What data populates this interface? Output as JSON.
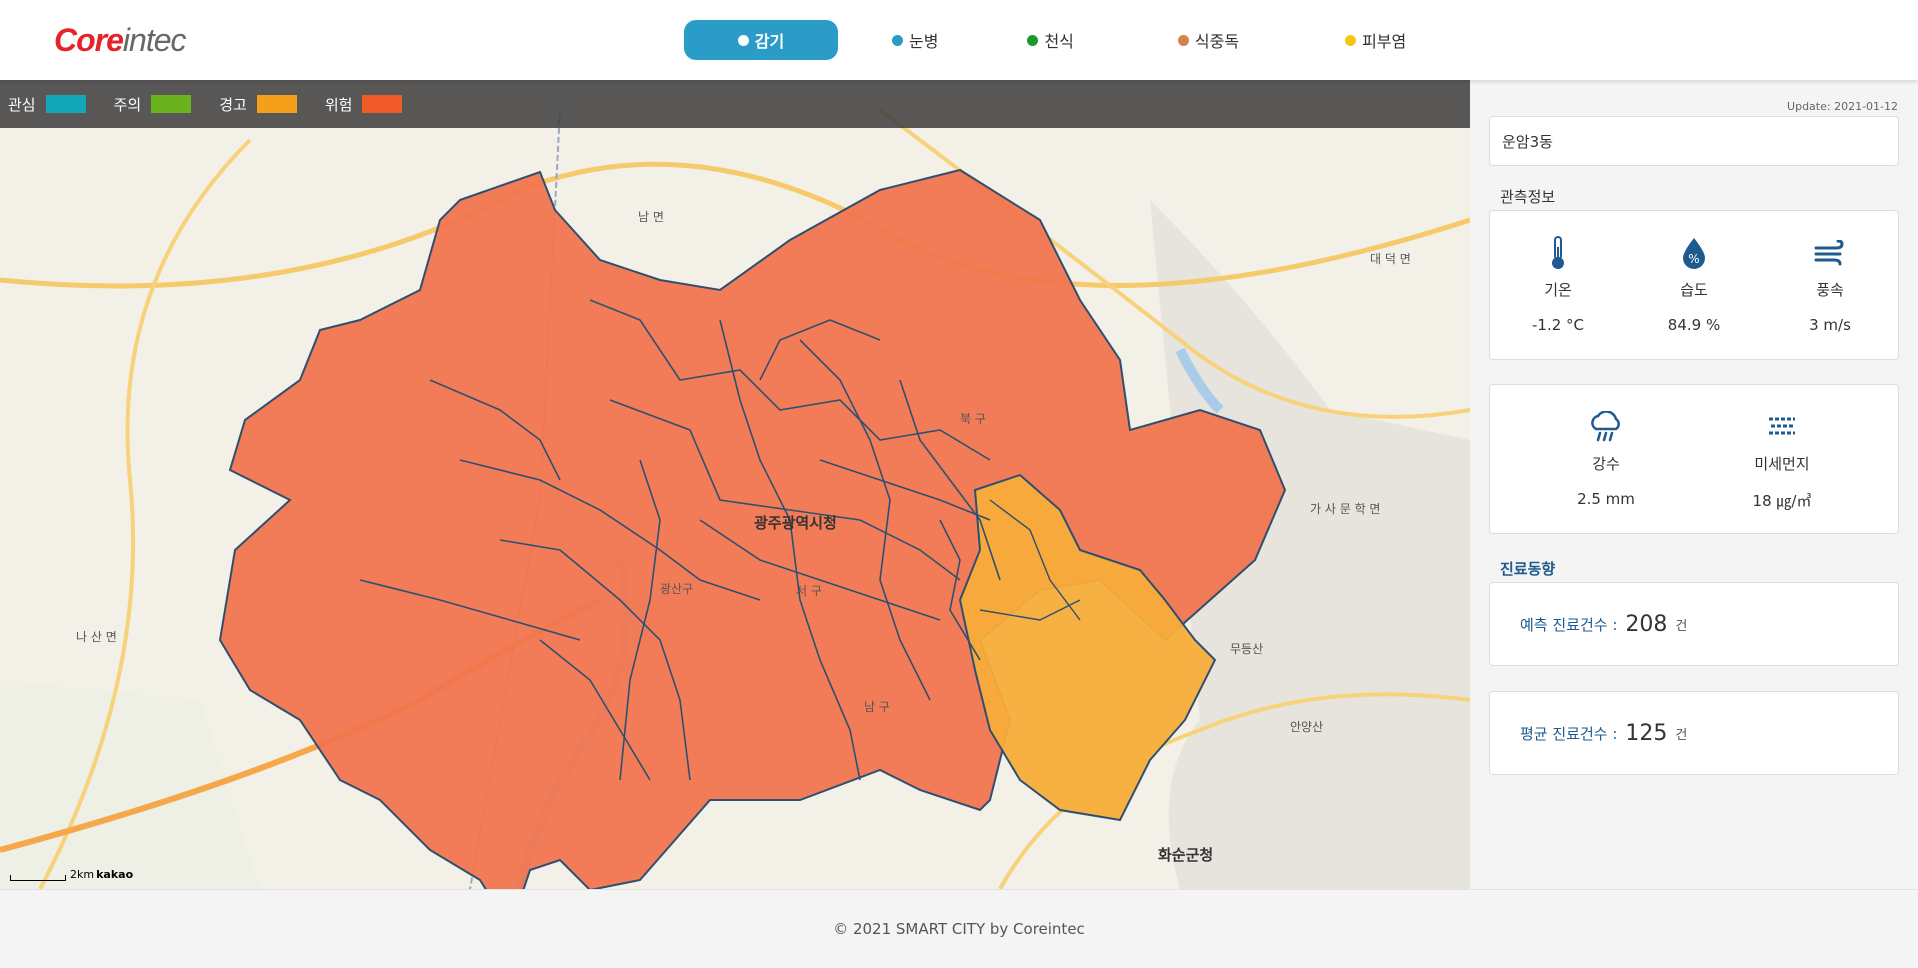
{
  "header": {
    "logo_core": "Core",
    "logo_intec": "intec",
    "tabs": [
      {
        "label": "감기",
        "color": "#2b9cc7",
        "active": true
      },
      {
        "label": "눈병",
        "color": "#2b9cc7",
        "active": false
      },
      {
        "label": "천식",
        "color": "#1a9a2a",
        "active": false
      },
      {
        "label": "식중독",
        "color": "#d5824a",
        "active": false
      },
      {
        "label": "피부염",
        "color": "#f5c518",
        "active": false
      }
    ]
  },
  "legend": [
    {
      "label": "관심",
      "color": "#12a8b8"
    },
    {
      "label": "주의",
      "color": "#6ab31e"
    },
    {
      "label": "경고",
      "color": "#f5a01a"
    },
    {
      "label": "위험",
      "color": "#f05a28"
    }
  ],
  "map": {
    "scale_label": "2km",
    "brand": "kakao",
    "city_label": "광주광역시청",
    "labels": [
      "나 산 면",
      "남 면",
      "북 구",
      "서 구",
      "남 구",
      "광산구",
      "화순군청",
      "대 덕 면",
      "가 사 문 학 면",
      "안양산",
      "무등산"
    ]
  },
  "side": {
    "update": "Update: 2021-01-12",
    "location": "운암3동",
    "observation_title": "관측정보",
    "metrics_row1": [
      {
        "icon": "thermometer-icon",
        "label": "기온",
        "value": "-1.2 °C"
      },
      {
        "icon": "humidity-icon",
        "label": "습도",
        "value": "84.9 %"
      },
      {
        "icon": "wind-icon",
        "label": "풍속",
        "value": "3 m/s"
      }
    ],
    "metrics_row2": [
      {
        "icon": "rain-icon",
        "label": "강수",
        "value": "2.5 mm"
      },
      {
        "icon": "fine-dust-icon",
        "label": "미세먼지",
        "value": "18 ㎍/㎥"
      }
    ],
    "trend_title": "진료동향",
    "predicted": {
      "label": "예측 진료건수 :",
      "value": "208",
      "unit": "건"
    },
    "average": {
      "label": "평균 진료건수 :",
      "value": "125",
      "unit": "건"
    }
  },
  "footer": {
    "text": "© 2021 SMART CITY by Coreintec"
  }
}
